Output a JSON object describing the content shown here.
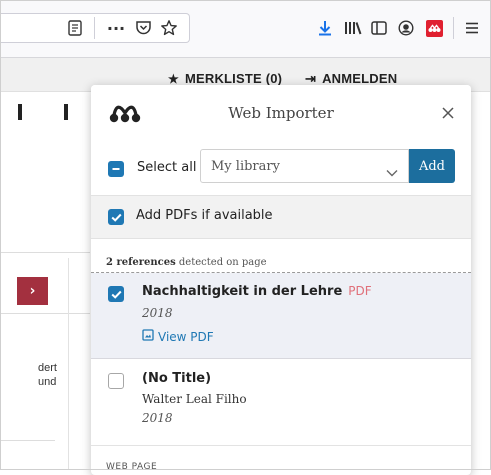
{
  "browser": {
    "toolbar_icons": [
      "reader-icon",
      "more-icon",
      "pocket-icon",
      "star-icon",
      "download-icon",
      "library-icon",
      "sidebar-icon",
      "account-icon",
      "mendeley-extension-icon",
      "menu-icon"
    ],
    "more_label": "···"
  },
  "page": {
    "header_items": [
      "MERKLISTE (0)",
      "ANMELDEN"
    ],
    "arrow_label": "›",
    "left_text": [
      "dert",
      "und"
    ]
  },
  "popup": {
    "title": "Web Importer",
    "select_all_label": "Select all",
    "library_value": "My library",
    "add_label": "Add",
    "add_pdfs_label": "Add PDFs if available",
    "detected_count": "2 references",
    "detected_suffix": " detected on page",
    "references": [
      {
        "title": "Nachhaltigkeit in der Lehre",
        "badge": "PDF",
        "year": "2018",
        "link": "View PDF",
        "checked": true
      },
      {
        "title": "(No Title)",
        "author": "Walter Leal Filho",
        "year": "2018",
        "checked": false
      }
    ],
    "webpage_label": "WEB PAGE"
  },
  "colors": {
    "accent": "#1f78b4",
    "add_button": "#1c6e9e",
    "pdf_badge": "#e0707a",
    "arrow_box": "#a3303f",
    "download_icon": "#1a73e8",
    "extension_icon": "#e02030"
  }
}
